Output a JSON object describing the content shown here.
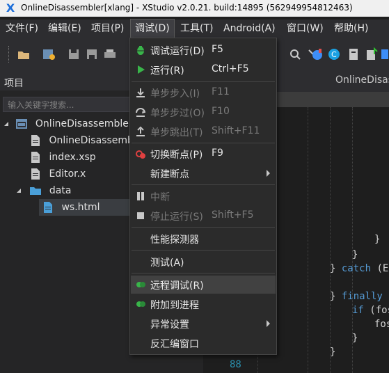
{
  "window": {
    "title": "OnlineDisassembler[xlang] - XStudio v2.0.21. build:14895 (562949954812463)",
    "app_icon": "X"
  },
  "menubar": [
    {
      "label": "文件(F)"
    },
    {
      "label": "编辑(E)"
    },
    {
      "label": "项目(P)"
    },
    {
      "label": "调试(D)"
    },
    {
      "label": "工具(T)"
    },
    {
      "label": "Android(A)"
    },
    {
      "label": "窗口(W)"
    },
    {
      "label": "帮助(H)"
    }
  ],
  "project_panel": {
    "title": "项目",
    "search_placeholder": "输入关键字搜索...",
    "tree": [
      {
        "label": "OnlineDisassembler",
        "icon": "project-icon"
      },
      {
        "label": "OnlineDisassembler",
        "icon": "file-icon"
      },
      {
        "label": "index.xsp",
        "icon": "file-icon"
      },
      {
        "label": "Editor.x",
        "icon": "file-icon"
      },
      {
        "label": "data",
        "icon": "folder-icon"
      },
      {
        "label": "ws.html",
        "icon": "file-icon"
      }
    ]
  },
  "editor": {
    "tab_label": "OnlineDisas",
    "line_number_visible": "88",
    "code": {
      "catch_kw": "catch",
      "catch_rest": " (Ex",
      "finally_kw": "finally",
      "if_kw": "if",
      "if_rest": " (fos",
      "fos_text": "fos"
    }
  },
  "debug_menu": {
    "items": [
      {
        "label": "调试运行(D)",
        "shortcut": "F5",
        "icon": "bug-icon"
      },
      {
        "label": "运行(R)",
        "shortcut": "Ctrl+F5",
        "icon": "play-icon"
      },
      {
        "label": "单步步入(I)",
        "shortcut": "F11",
        "icon": "step-into-icon"
      },
      {
        "label": "单步步过(O)",
        "shortcut": "F10",
        "icon": "step-over-icon"
      },
      {
        "label": "单步跳出(T)",
        "shortcut": "Shift+F11",
        "icon": "step-out-icon"
      },
      {
        "label": "切换断点(P)",
        "shortcut": "F9",
        "icon": "breakpoint-icon"
      },
      {
        "label": "新建断点",
        "shortcut": "",
        "icon": ""
      },
      {
        "label": "中断",
        "shortcut": "",
        "icon": "pause-icon"
      },
      {
        "label": "停止运行(S)",
        "shortcut": "Shift+F5",
        "icon": "stop-icon"
      },
      {
        "label": "性能探测器",
        "shortcut": "",
        "icon": ""
      },
      {
        "label": "测试(A)",
        "shortcut": "",
        "icon": ""
      },
      {
        "label": "远程调试(R)",
        "shortcut": "",
        "icon": "remote-debug-icon"
      },
      {
        "label": "附加到进程",
        "shortcut": "",
        "icon": "attach-process-icon"
      },
      {
        "label": "异常设置",
        "shortcut": "",
        "icon": ""
      },
      {
        "label": "反汇编窗口",
        "shortcut": "",
        "icon": ""
      }
    ]
  },
  "colors": {
    "accent": "#1e6fd9",
    "menu_bg": "#2b2b2b",
    "editor_bg": "#1e1e1e",
    "keyword": "#569cd6"
  }
}
